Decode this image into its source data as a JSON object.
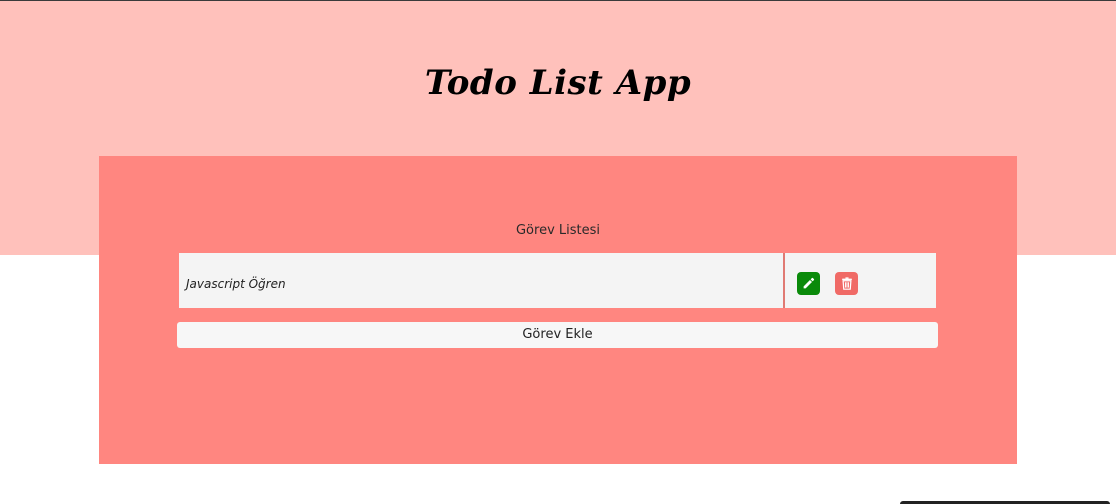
{
  "header": {
    "title": "Todo List App"
  },
  "panel": {
    "heading": "Görev Listesi",
    "tasks": [
      {
        "text": "Javascript Öğren",
        "edit_icon": "pencil-icon",
        "delete_icon": "trash-icon"
      }
    ],
    "add_button_label": "Görev Ekle"
  },
  "colors": {
    "hero_background": "#ffc1bb",
    "panel_background": "#ff8680",
    "task_background": "#f4f4f4",
    "edit_button": "#0a8a0a",
    "delete_button": "#f06a66"
  }
}
